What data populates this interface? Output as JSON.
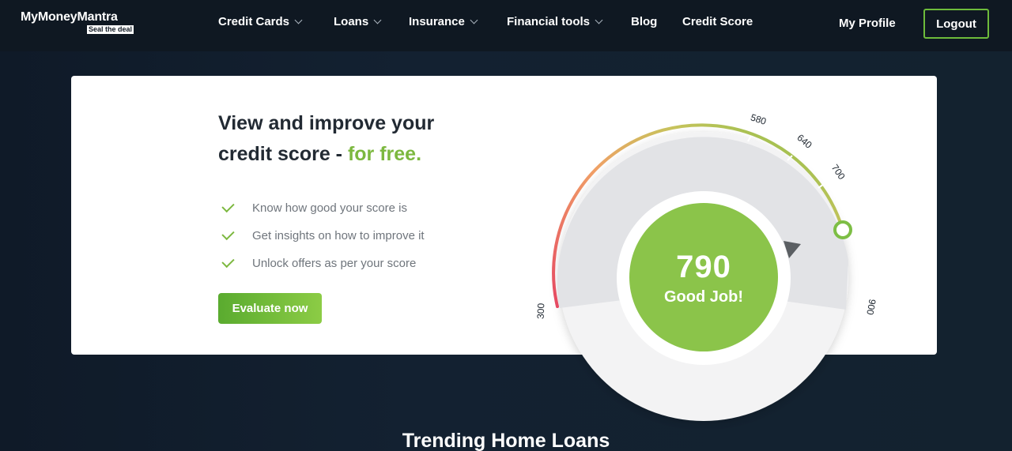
{
  "brand": {
    "name": "MyMoneyMantra",
    "tagline": "Seal the deal"
  },
  "nav": {
    "items": [
      {
        "label": "Credit Cards",
        "has_dropdown": true
      },
      {
        "label": "Loans",
        "has_dropdown": true
      },
      {
        "label": "Insurance",
        "has_dropdown": true
      },
      {
        "label": "Financial tools",
        "has_dropdown": true
      },
      {
        "label": "Blog",
        "has_dropdown": false
      },
      {
        "label": "Credit Score",
        "has_dropdown": false
      }
    ],
    "profile_label": "My Profile",
    "logout_label": "Logout"
  },
  "hero": {
    "headline_line1": "View and improve your",
    "headline_line2_prefix": "credit score - ",
    "headline_accent": "for free.",
    "features": [
      "Know how good your score is",
      "Get insights on how to improve it",
      "Unlock offers as per your score"
    ],
    "cta_label": "Evaluate now"
  },
  "gauge": {
    "score": "790",
    "verdict": "Good Job!",
    "ticks": [
      "300",
      "580",
      "640",
      "700",
      "900"
    ],
    "range": {
      "min": 300,
      "max": 900
    },
    "value": 790
  },
  "colors": {
    "accent_green": "#7cb83f",
    "score_fill": "#8bc44a",
    "background_dark": "#0f1822",
    "arc_red": "#e54862",
    "arc_orange": "#f0a066"
  },
  "sections": {
    "trending_title": "Trending Home Loans"
  }
}
